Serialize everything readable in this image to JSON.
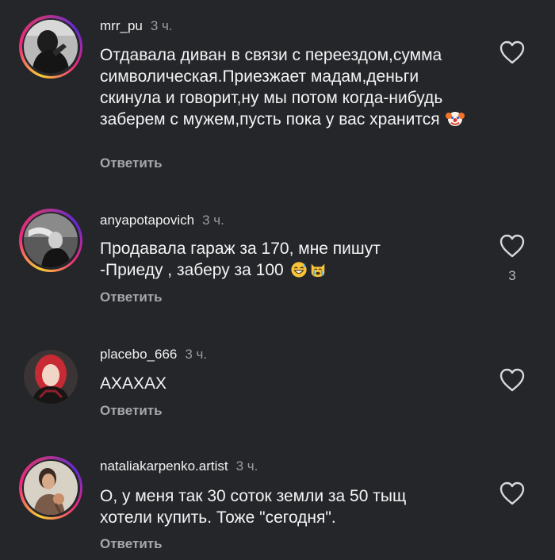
{
  "comments": [
    {
      "username": "mrr_pu",
      "time": "3 ч.",
      "text": "Отдавала диван в связи с переездом,сумма символическая.Приезжает мадам,деньги скинула и говорит,ну мы потом когда-нибудь заберем с мужем,пусть пока у вас хранится",
      "emoji": "clown-face",
      "reply": "Ответить"
    },
    {
      "username": "anyapotapovich",
      "time": "3 ч.",
      "text": "Продавала гараж за 170, мне пишут -Приеду , заберу за 100",
      "emoji": "grinning-sweat-face, crying-cat-face",
      "reply": "Ответить",
      "likes": "3"
    },
    {
      "username": "placebo_666",
      "time": "3 ч.",
      "text": "АХАХАХ",
      "reply": "Ответить"
    },
    {
      "username": "nataliakarpenko.artist",
      "time": "3 ч.",
      "text": "О, у меня так 30 соток земли за 50 тыщ хотели купить. Тоже \"сегодня\".",
      "reply": "Ответить"
    }
  ],
  "icons": {
    "like": "heart-outline-icon"
  },
  "colors": {
    "background": "#25262a",
    "text": "#f4f4f4",
    "muted": "#9a9ba0",
    "ring_start": "#f9ce34",
    "ring_mid": "#ee2a7b",
    "ring_end": "#6228d7"
  }
}
